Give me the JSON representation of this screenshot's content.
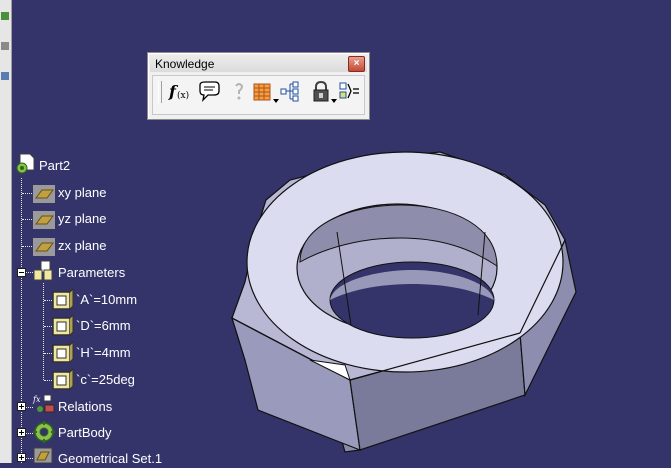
{
  "toolbar": {
    "title": "Knowledge",
    "close_symbol": "×",
    "buttons": [
      {
        "name": "formula-icon",
        "label": "f(x)"
      },
      {
        "name": "comment-icon"
      },
      {
        "name": "help-icon"
      },
      {
        "name": "design-table-icon",
        "dropdown": true
      },
      {
        "name": "law-tree-icon"
      },
      {
        "name": "lock-icon",
        "dropdown": true
      },
      {
        "name": "equivalent-dimensions-icon"
      }
    ]
  },
  "tree": {
    "root": "Part2",
    "planes": [
      "xy plane",
      "yz plane",
      "zx plane"
    ],
    "parameters_label": "Parameters",
    "parameters": [
      "`A`=10mm",
      "`D`=6mm",
      "`H`=4mm",
      "`c`=25deg"
    ],
    "relations_label": "Relations",
    "partbody_label": "PartBody",
    "geomset_label": "Geometrical Set.1"
  },
  "colors": {
    "background": "#34346b",
    "nut_face_light": "#e4e4f4",
    "nut_face_mid": "#a8a8c8",
    "nut_face_dark": "#6a6a8c"
  }
}
